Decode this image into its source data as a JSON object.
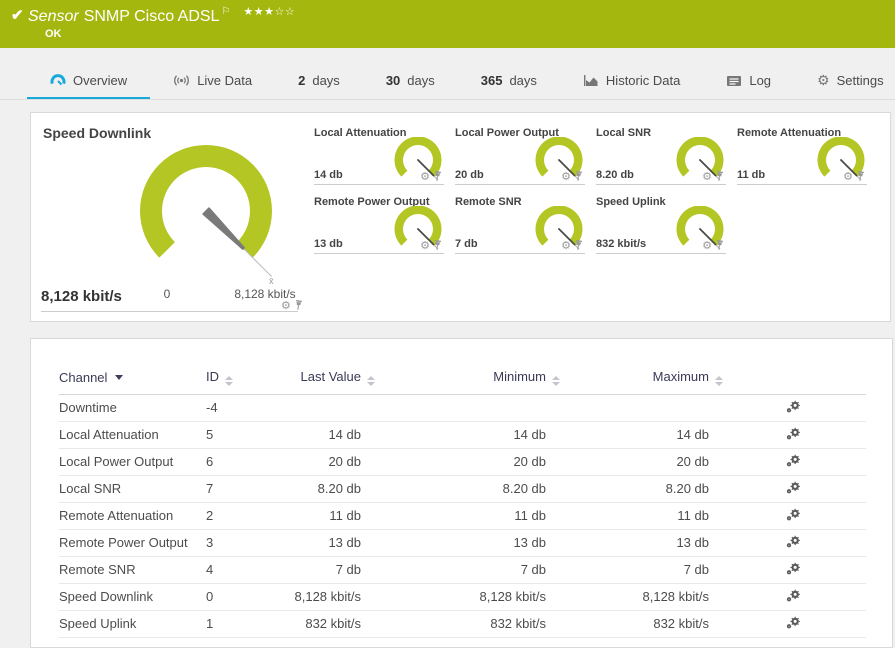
{
  "header": {
    "status_icon": "✔",
    "type_label": "Sensor",
    "name": "SNMP Cisco ADSL",
    "flag_icon": "⚐",
    "stars_filled": "★★★",
    "stars_empty": "☆☆",
    "status": "OK",
    "bg_color": "#a4b70e"
  },
  "tabs": {
    "overview": "Overview",
    "live_data": "Live Data",
    "d2_num": "2",
    "d2_label": "days",
    "d30_num": "30",
    "d30_label": "days",
    "d365_num": "365",
    "d365_label": "days",
    "historic": "Historic Data",
    "log": "Log",
    "settings": "Settings",
    "settings_gear": "⚙",
    "active_color": "#18a9dc"
  },
  "gauges": {
    "accent_color": "#b4c624",
    "needle_color": "#7a7a7a",
    "small_needle_color": "#4a4a4a",
    "avg_marker": "x̄",
    "gear_glyph": "⚙",
    "main": {
      "title": "Speed Downlink",
      "value": "8,128 kbit/s",
      "min_label": "0",
      "max_label": "8,128 kbit/s"
    },
    "small": [
      {
        "title": "Local Attenuation",
        "value": "14 db"
      },
      {
        "title": "Local Power Output",
        "value": "20 db"
      },
      {
        "title": "Local SNR",
        "value": "8.20 db"
      },
      {
        "title": "Remote Attenuation",
        "value": "11 db"
      },
      {
        "title": "Remote Power Output",
        "value": "13 db"
      },
      {
        "title": "Remote SNR",
        "value": "7 db"
      },
      {
        "title": "Speed Uplink",
        "value": "832 kbit/s"
      }
    ]
  },
  "table": {
    "columns": {
      "channel": "Channel",
      "id": "ID",
      "last": "Last Value",
      "min": "Minimum",
      "max": "Maximum"
    },
    "rows": [
      {
        "channel": "Downtime",
        "id": "-4",
        "last": "",
        "min": "",
        "max": ""
      },
      {
        "channel": "Local Attenuation",
        "id": "5",
        "last": "14 db",
        "min": "14 db",
        "max": "14 db"
      },
      {
        "channel": "Local Power Output",
        "id": "6",
        "last": "20 db",
        "min": "20 db",
        "max": "20 db"
      },
      {
        "channel": "Local SNR",
        "id": "7",
        "last": "8.20 db",
        "min": "8.20 db",
        "max": "8.20 db"
      },
      {
        "channel": "Remote Attenuation",
        "id": "2",
        "last": "11 db",
        "min": "11 db",
        "max": "11 db"
      },
      {
        "channel": "Remote Power Output",
        "id": "3",
        "last": "13 db",
        "min": "13 db",
        "max": "13 db"
      },
      {
        "channel": "Remote SNR",
        "id": "4",
        "last": "7 db",
        "min": "7 db",
        "max": "7 db"
      },
      {
        "channel": "Speed Downlink",
        "id": "0",
        "last": "8,128 kbit/s",
        "min": "8,128 kbit/s",
        "max": "8,128 kbit/s"
      },
      {
        "channel": "Speed Uplink",
        "id": "1",
        "last": "832 kbit/s",
        "min": "832 kbit/s",
        "max": "832 kbit/s"
      }
    ]
  }
}
